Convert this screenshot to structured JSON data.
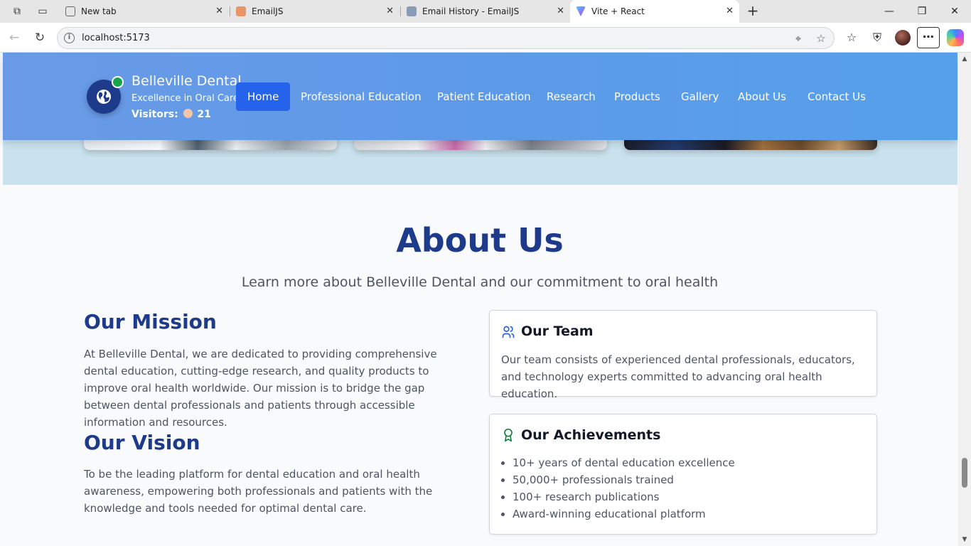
{
  "browser": {
    "tabs": [
      {
        "label": "New tab",
        "favicon": "new-tab-icon"
      },
      {
        "label": "EmailJS",
        "favicon": "emailjs-icon"
      },
      {
        "label": "Email History - EmailJS",
        "favicon": "emailjs-icon"
      },
      {
        "label": "Vite + React",
        "favicon": "vite-icon",
        "active": true
      }
    ],
    "url": "localhost:5173"
  },
  "header": {
    "brand_title": "Belleville Dental",
    "brand_subtitle": "Excellence in Oral Care",
    "visitors_label": "Visitors:",
    "visitors_count": "21",
    "nav": [
      {
        "label": "Home",
        "active": true
      },
      {
        "label": "Professional Education"
      },
      {
        "label": "Patient Education"
      },
      {
        "label": "Research"
      },
      {
        "label": "Products"
      },
      {
        "label": "Gallery"
      },
      {
        "label": "About Us"
      },
      {
        "label": "Contact Us"
      }
    ],
    "colors": {
      "header_bg": "#5d9ae8",
      "active_nav": "#2563eb",
      "logo_bg": "#1e3a8a",
      "online": "#16a34a"
    }
  },
  "about": {
    "title": "About Us",
    "subtitle": "Learn more about Belleville Dental and our commitment to oral health",
    "mission": {
      "heading": "Our Mission",
      "text": "At Belleville Dental, we are dedicated to providing comprehensive dental education, cutting-edge research, and quality products to improve oral health worldwide. Our mission is to bridge the gap between dental professionals and patients through accessible information and resources."
    },
    "vision": {
      "heading": "Our Vision",
      "text": "To be the leading platform for dental education and oral health awareness, empowering both professionals and patients with the knowledge and tools needed for optimal dental care."
    },
    "team": {
      "heading": "Our Team",
      "icon": "users-icon",
      "text": "Our team consists of experienced dental professionals, educators, and technology experts committed to advancing oral health education."
    },
    "achievements": {
      "heading": "Our Achievements",
      "icon": "award-icon",
      "items": [
        "10+ years of dental education excellence",
        "50,000+ professionals trained",
        "100+ research publications",
        "Award-winning educational platform"
      ]
    },
    "colors": {
      "heading": "#1e3a8a",
      "body_text": "#4b5563"
    }
  }
}
